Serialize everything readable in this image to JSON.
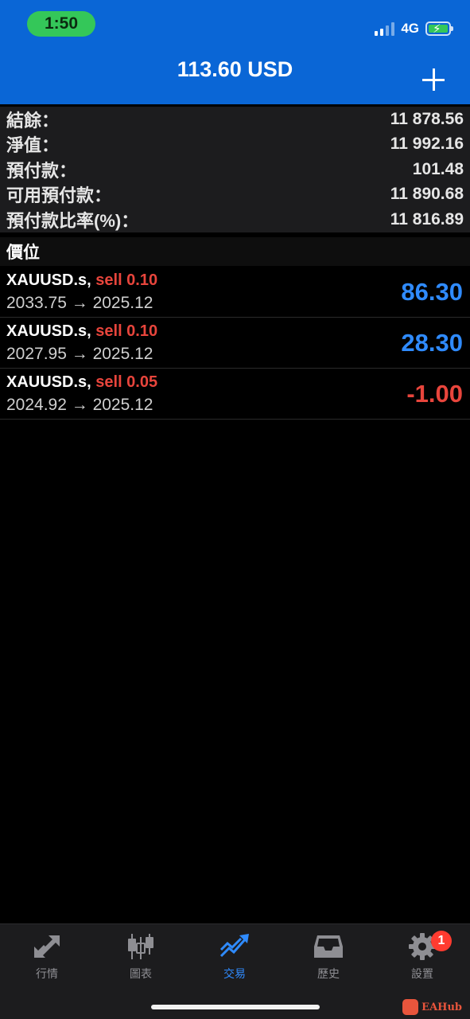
{
  "status_bar": {
    "time": "1:50",
    "network": "4G"
  },
  "header": {
    "title": "113.60 USD"
  },
  "summary": [
    {
      "label": "結餘：",
      "value": "11 878.56"
    },
    {
      "label": "淨值：",
      "value": "11 992.16"
    },
    {
      "label": "預付款：",
      "value": "101.48"
    },
    {
      "label": "可用預付款：",
      "value": "11 890.68"
    },
    {
      "label": "預付款比率(%)：",
      "value": "11 816.89"
    }
  ],
  "positions_section": {
    "title": "價位"
  },
  "positions": [
    {
      "symbol": "XAUUSD.s,",
      "type": "sell 0.10",
      "prices": "2033.75 → 2025.12",
      "profit": "86.30"
    },
    {
      "symbol": "XAUUSD.s,",
      "type": "sell 0.10",
      "prices": "2027.95 → 2025.12",
      "profit": "28.30"
    },
    {
      "symbol": "XAUUSD.s,",
      "type": "sell 0.05",
      "prices": "2024.92 → 2025.12",
      "profit": "-1.00"
    }
  ],
  "tabs": [
    {
      "label": "行情",
      "icon": "quotes-arrows-icon",
      "active": false
    },
    {
      "label": "圖表",
      "icon": "candlestick-chart-icon",
      "active": false
    },
    {
      "label": "交易",
      "icon": "trade-trend-icon",
      "active": true
    },
    {
      "label": "歷史",
      "icon": "history-inbox-icon",
      "active": false
    },
    {
      "label": "設置",
      "icon": "settings-gear-icon",
      "active": false
    }
  ],
  "settings_badge": "1",
  "watermark": "EAHub",
  "colors": {
    "header_bg": "#0a66d6",
    "profit_positive": "#2f8bff",
    "profit_negative": "#e8453c",
    "sell": "#e8453c",
    "tab_active": "#2f8bff",
    "tab_inactive": "#8e8e93"
  }
}
